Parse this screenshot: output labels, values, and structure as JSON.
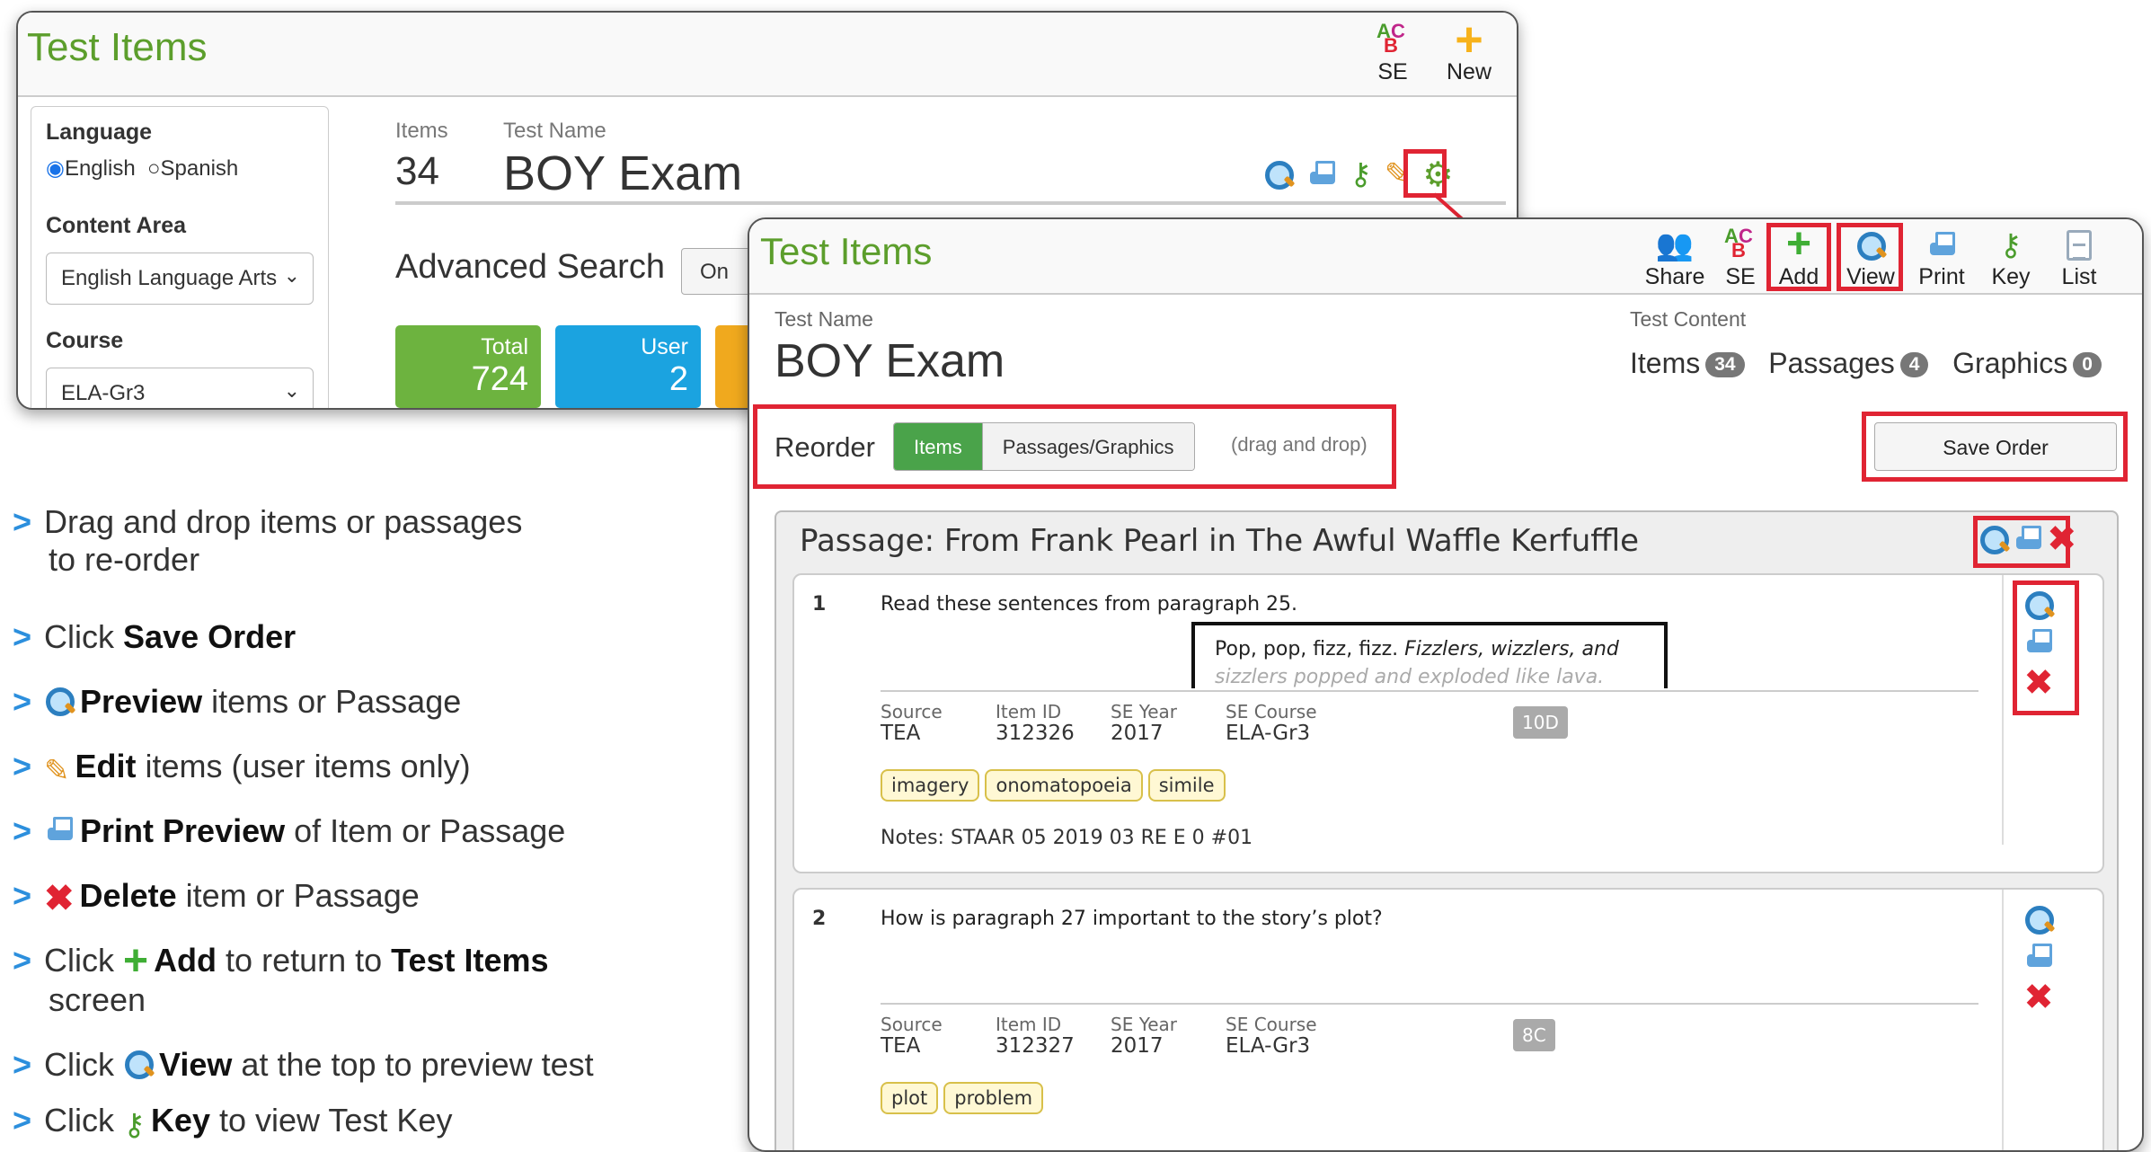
{
  "back_window": {
    "title": "Test Items",
    "toolbar": {
      "se_label": "SE",
      "new_label": "New"
    },
    "sidebar": {
      "language_label": "Language",
      "language_options": [
        "English",
        "Spanish"
      ],
      "content_area_label": "Content Area",
      "content_area_value": "English Language Arts",
      "course_label": "Course",
      "course_value": "ELA-Gr3"
    },
    "header": {
      "items_label": "Items",
      "items_count": "34",
      "test_name_label": "Test Name",
      "test_name": "BOY Exam"
    },
    "advanced_search": {
      "label": "Advanced Search",
      "toggle": "On"
    },
    "tiles": [
      {
        "label": "Total",
        "value": "724",
        "color": "#6db33f"
      },
      {
        "label": "User",
        "value": "2",
        "color": "#1ba3e0"
      }
    ]
  },
  "front_window": {
    "title": "Test Items",
    "toolbar": [
      "Share",
      "SE",
      "Add",
      "View",
      "Print",
      "Key",
      "List"
    ],
    "test_name_label": "Test Name",
    "test_name": "BOY Exam",
    "test_content_label": "Test Content",
    "content_counts": [
      {
        "label": "Items",
        "count": "34"
      },
      {
        "label": "Passages",
        "count": "4"
      },
      {
        "label": "Graphics",
        "count": "0"
      }
    ],
    "reorder": {
      "label": "Reorder",
      "items_btn": "Items",
      "passages_btn": "Passages/Graphics",
      "hint": "(drag and drop)"
    },
    "save_order": "Save Order",
    "passage_title": "Passage: From Frank Pearl in The Awful Waffle Kerfuffle",
    "items": [
      {
        "number": "1",
        "question": "Read these sentences from paragraph 25.",
        "excerpt_plain": "Pop, pop, fizz, fizz. ",
        "excerpt_italic": "Fizzlers, wizzlers, and",
        "excerpt_line2": "sizzlers popped and exploded like lava.",
        "meta": [
          [
            "Source",
            "TEA"
          ],
          [
            "Item ID",
            "312326"
          ],
          [
            "SE Year",
            "2017"
          ],
          [
            "SE Course",
            "ELA-Gr3"
          ]
        ],
        "se_code": "10D",
        "tags": [
          "imagery",
          "onomatopoeia",
          "simile"
        ],
        "notes": "Notes: STAAR 05 2019 03 RE E 0 #01"
      },
      {
        "number": "2",
        "question": "How is paragraph 27 important to the story’s plot?",
        "meta": [
          [
            "Source",
            "TEA"
          ],
          [
            "Item ID",
            "312327"
          ],
          [
            "SE Year",
            "2017"
          ],
          [
            "SE Course",
            "ELA-Gr3"
          ]
        ],
        "se_code": "8C",
        "tags": [
          "plot",
          "problem"
        ]
      }
    ]
  },
  "instructions": [
    {
      "pre": "Drag and drop items or passages",
      "line2": "to re-order"
    },
    {
      "pre": "Click ",
      "bold": "Save Order",
      "post": ""
    },
    {
      "icon": "magnifier-icon",
      "bold": "Preview",
      "post": " items or Passage"
    },
    {
      "icon": "pencil-icon",
      "bold": "Edit",
      "post": " items (user items only)"
    },
    {
      "icon": "printer-icon",
      "bold": "Print Preview",
      "post": " of Item or Passage"
    },
    {
      "icon": "delete-icon",
      "bold": "Delete",
      "post": " item or Passage"
    },
    {
      "pre": "Click ",
      "icon": "plus-icon",
      "bold": "Add",
      "post": " to return to ",
      "bold2": "Test Items",
      "line2": "screen"
    },
    {
      "pre": "Click ",
      "icon": "magnifier-icon",
      "bold": "View",
      "post": " at the top to preview test"
    },
    {
      "pre": "Click ",
      "icon": "key-icon",
      "bold": "Key",
      "post": " to view Test Key"
    }
  ],
  "colors": {
    "accent_green": "#5c9e2c",
    "highlight_red": "#e02433",
    "bullet_blue": "#2c8fdd",
    "badge_gray": "#777777"
  }
}
